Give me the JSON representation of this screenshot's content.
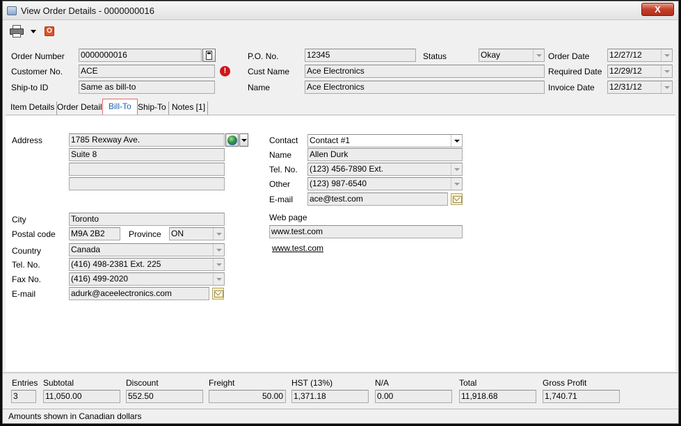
{
  "window": {
    "title": "View Order Details - 0000000016",
    "close_label": "X"
  },
  "toolbar": {
    "power_label": "O"
  },
  "header": {
    "order_number_label": "Order Number",
    "order_number": "0000000016",
    "customer_no_label": "Customer No.",
    "customer_no": "ACE",
    "ship_to_id_label": "Ship-to ID",
    "ship_to_id": "Same as bill-to",
    "po_no_label": "P.O. No.",
    "po_no": "12345",
    "cust_name_label": "Cust Name",
    "cust_name": "Ace Electronics",
    "name_label": "Name",
    "name": "Ace Electronics",
    "status_label": "Status",
    "status": "Okay",
    "order_date_label": "Order Date",
    "order_date": "12/27/12",
    "required_date_label": "Required Date",
    "required_date": "12/29/12",
    "invoice_date_label": "Invoice Date",
    "invoice_date": "12/31/12",
    "warning_glyph": "!"
  },
  "tabs": [
    {
      "label": "Item Details"
    },
    {
      "label": "Order Details"
    },
    {
      "label": "Bill-To"
    },
    {
      "label": "Ship-To"
    },
    {
      "label": "Notes [1]"
    }
  ],
  "bill_to": {
    "address_label": "Address",
    "address": [
      "1785 Rexway Ave.",
      "Suite 8",
      "",
      ""
    ],
    "city_label": "City",
    "city": "Toronto",
    "postal_label": "Postal code",
    "postal": "M9A 2B2",
    "province_label": "Province",
    "province": "ON",
    "country_label": "Country",
    "country": "Canada",
    "tel_label": "Tel. No.",
    "tel": "(416) 498-2381 Ext. 225",
    "fax_label": "Fax No.",
    "fax": "(416) 499-2020",
    "email_label": "E-mail",
    "email": "adurk@aceelectronics.com",
    "contact_label": "Contact",
    "contact": "Contact #1",
    "contact_name_label": "Name",
    "contact_name": "Allen Durk",
    "contact_tel_label": "Tel. No.",
    "contact_tel": "(123) 456-7890 Ext.",
    "other_label": "Other",
    "other": "(123) 987-6540",
    "contact_email_label": "E-mail",
    "contact_email": "ace@test.com",
    "web_label": "Web page",
    "web": "www.test.com",
    "web_link": "www.test.com"
  },
  "totals": {
    "entries_label": "Entries",
    "entries": "3",
    "subtotal_label": "Subtotal",
    "subtotal": "11,050.00",
    "discount_label": "Discount",
    "discount": "552.50",
    "freight_label": "Freight",
    "freight": "50.00",
    "hst_label": "HST (13%)",
    "hst": "1,371.18",
    "na_label": "N/A",
    "na": "0.00",
    "total_label": "Total",
    "total": "11,918.68",
    "gross_profit_label": "Gross Profit",
    "gross_profit": "1,740.71"
  },
  "status_bar": {
    "text": "Amounts shown in Canadian dollars"
  }
}
